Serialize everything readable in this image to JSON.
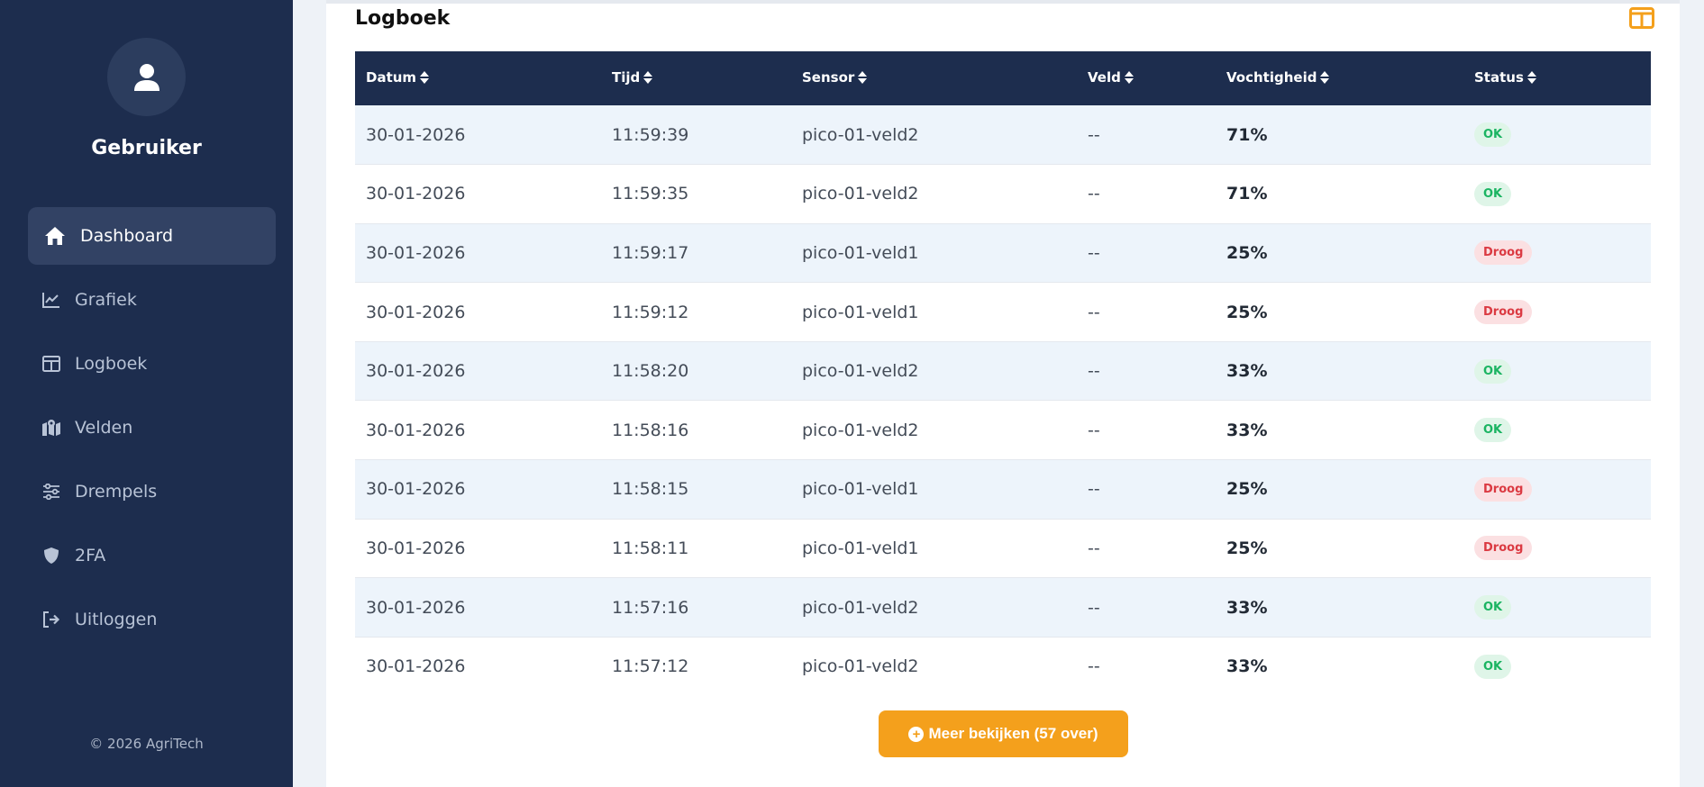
{
  "sidebar": {
    "avatar_icon": "user-icon",
    "username": "Gebruiker",
    "items": [
      {
        "label": "Dashboard",
        "icon": "home-icon",
        "active": true
      },
      {
        "label": "Grafiek",
        "icon": "chart-line-icon",
        "active": false
      },
      {
        "label": "Logboek",
        "icon": "table-icon",
        "active": false
      },
      {
        "label": "Velden",
        "icon": "map-icon",
        "active": false
      },
      {
        "label": "Drempels",
        "icon": "sliders-icon",
        "active": false
      },
      {
        "label": "2FA",
        "icon": "shield-icon",
        "active": false
      },
      {
        "label": "Uitloggen",
        "icon": "sign-out-icon",
        "active": false
      }
    ],
    "footer": "© 2026 AgriTech"
  },
  "main": {
    "title": "Logboek",
    "header_icon": "columns-icon",
    "table": {
      "columns": [
        "Datum",
        "Tijd",
        "Sensor",
        "Veld",
        "Vochtigheid",
        "Status"
      ],
      "rows": [
        {
          "datum": "30-01-2026",
          "tijd": "11:59:39",
          "sensor": "pico-01-veld2",
          "veld": "--",
          "vochtigheid": "71%",
          "status": "OK"
        },
        {
          "datum": "30-01-2026",
          "tijd": "11:59:35",
          "sensor": "pico-01-veld2",
          "veld": "--",
          "vochtigheid": "71%",
          "status": "OK"
        },
        {
          "datum": "30-01-2026",
          "tijd": "11:59:17",
          "sensor": "pico-01-veld1",
          "veld": "--",
          "vochtigheid": "25%",
          "status": "Droog"
        },
        {
          "datum": "30-01-2026",
          "tijd": "11:59:12",
          "sensor": "pico-01-veld1",
          "veld": "--",
          "vochtigheid": "25%",
          "status": "Droog"
        },
        {
          "datum": "30-01-2026",
          "tijd": "11:58:20",
          "sensor": "pico-01-veld2",
          "veld": "--",
          "vochtigheid": "33%",
          "status": "OK"
        },
        {
          "datum": "30-01-2026",
          "tijd": "11:58:16",
          "sensor": "pico-01-veld2",
          "veld": "--",
          "vochtigheid": "33%",
          "status": "OK"
        },
        {
          "datum": "30-01-2026",
          "tijd": "11:58:15",
          "sensor": "pico-01-veld1",
          "veld": "--",
          "vochtigheid": "25%",
          "status": "Droog"
        },
        {
          "datum": "30-01-2026",
          "tijd": "11:58:11",
          "sensor": "pico-01-veld1",
          "veld": "--",
          "vochtigheid": "25%",
          "status": "Droog"
        },
        {
          "datum": "30-01-2026",
          "tijd": "11:57:16",
          "sensor": "pico-01-veld2",
          "veld": "--",
          "vochtigheid": "33%",
          "status": "OK"
        },
        {
          "datum": "30-01-2026",
          "tijd": "11:57:12",
          "sensor": "pico-01-veld2",
          "veld": "--",
          "vochtigheid": "33%",
          "status": "OK"
        }
      ]
    },
    "more_button": {
      "label": "Meer bekijken (57 over)",
      "icon": "plus-circle-icon"
    }
  },
  "colors": {
    "sidebar_bg": "#1d2d4e",
    "accent": "#f4a01c",
    "ok": "#1bb462",
    "droog": "#db3a42"
  }
}
